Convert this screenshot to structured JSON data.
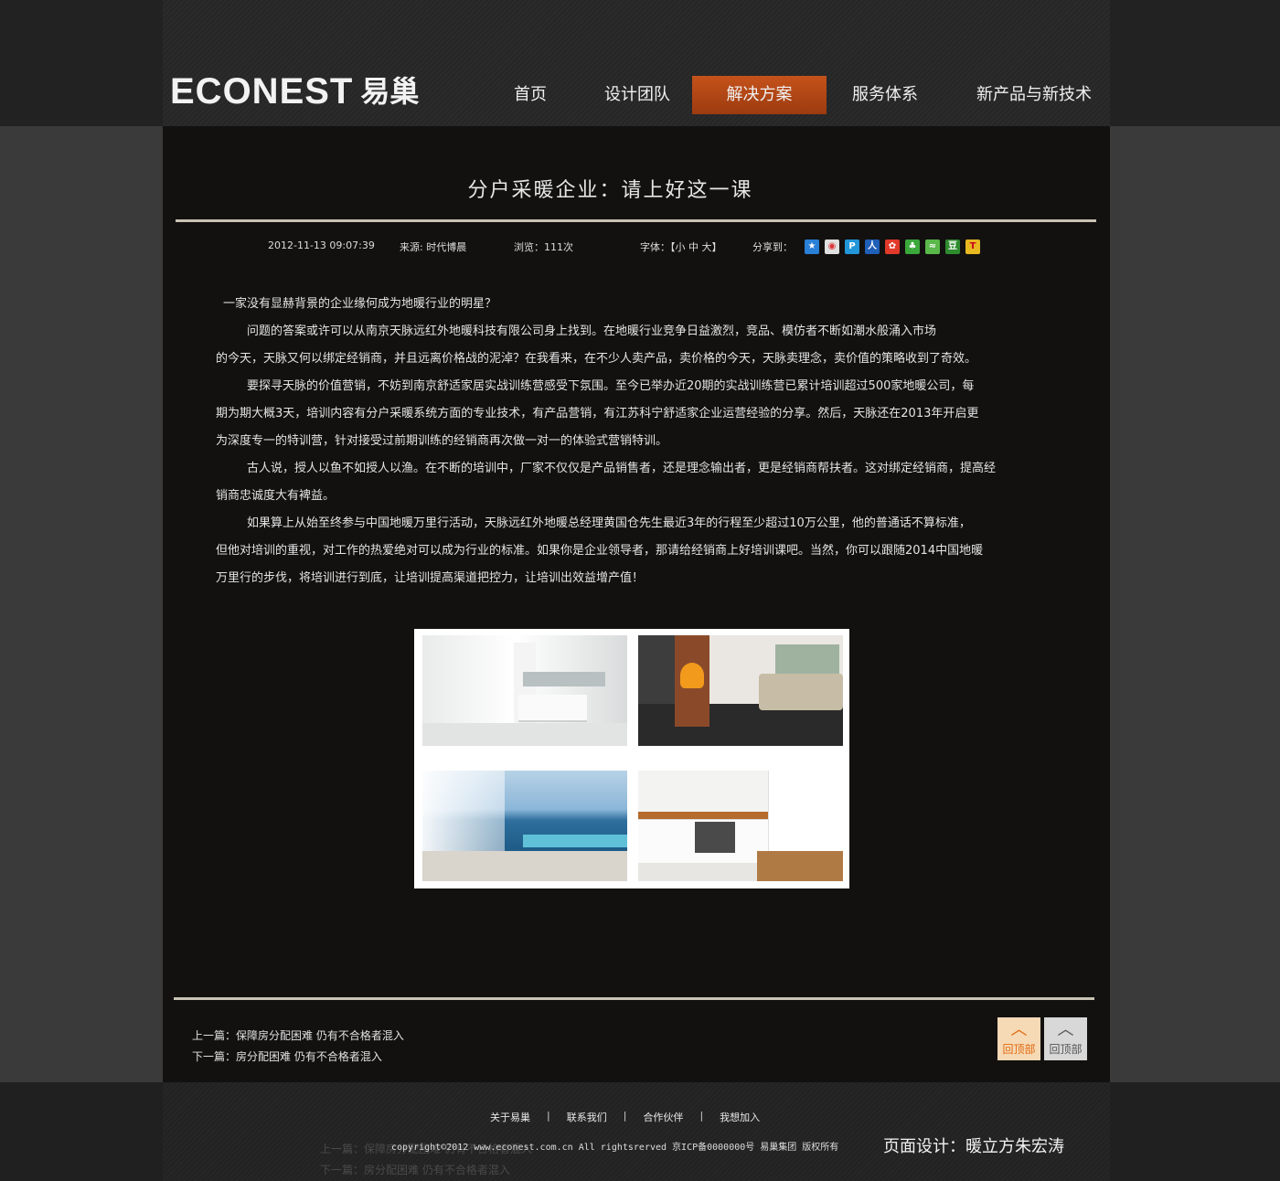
{
  "header": {
    "logo_text": "ECONEST",
    "logo_cn": "易巢",
    "nav": [
      {
        "label": "首页",
        "active": false
      },
      {
        "label": "设计团队",
        "active": false
      },
      {
        "label": "解决方案",
        "active": true
      },
      {
        "label": "服务体系",
        "active": false
      },
      {
        "label": "新产品与新技术",
        "active": false
      }
    ]
  },
  "article": {
    "title": "分户采暖企业：请上好这一课",
    "date": "2012-11-13 09:07:39",
    "source": "来源: 时代博晨",
    "views": "浏览：111次",
    "font_size_label": "字体：【小  中  大】",
    "share_label": "分享到：",
    "share_icons": [
      "qzone-icon",
      "weibo-icon",
      "pengyou-icon",
      "renren-icon",
      "kaixin-icon",
      "clover-icon",
      "tqq-icon",
      "douban-icon",
      "tieba-icon"
    ],
    "paragraphs": [
      "一家没有显赫背景的企业缘何成为地暖行业的明星？",
      "问题的答案或许可以从南京天脉远红外地暖科技有限公司身上找到。在地暖行业竞争日益激烈，竞品、模仿者不断如潮水般涌入市场",
      "的今天，天脉又何以绑定经销商，并且远离价格战的泥淖？在我看来，在不少人卖产品，卖价格的今天，天脉卖理念，卖价值的策略收到了奇效。",
      "要探寻天脉的价值营销，不妨到南京舒适家居实战训练营感受下氛围。至今已举办近20期的实战训练营已累计培训超过500家地暖公司，每",
      "期为期大概3天，培训内容有分户采暖系统方面的专业技术，有产品营销，有江苏科宁舒适家企业运营经验的分享。然后，天脉还在2013年开启更",
      "为深度专一的特训营，针对接受过前期训练的经销商再次做一对一的体验式营销特训。",
      "古人说，授人以鱼不如授人以渔。在不断的培训中，厂家不仅仅是产品销售者，还是理念输出者，更是经销商帮扶者。这对绑定经销商，提高经",
      "销商忠诚度大有裨益。",
      "如果算上从始至终参与中国地暖万里行活动，天脉远红外地暖总经理黄国仓先生最近3年的行程至少超过10万公里，他的普通话不算标准，",
      "但他对培训的重视，对工作的热爱绝对可以成为行业的标准。如果你是企业领导者，那请给经销商上好培训课吧。当然，你可以跟随2014中国地暖",
      "万里行的步伐，将培训进行到底，让培训提高渠道把控力，让培训出效益增产值！"
    ]
  },
  "pager": {
    "prev": "上一篇：保障房分配困难 仍有不合格者混入",
    "next": "下一篇：房分配困难 仍有不合格者混入",
    "back_top_1": "回顶部",
    "back_top_2": "回顶部"
  },
  "footer": {
    "links": [
      "关于易巢",
      "联系我们",
      "合作伙伴",
      "我想加入"
    ],
    "copyright": "copyright©2012 www.econest.com.cn All rightsrerved 京ICP备0000000号 易巢集团 版权所有",
    "designer": "页面设计：暖立方朱宏涛",
    "ghost_prev": "上一篇：保障房分配困难 仍有不合格者混入",
    "ghost_next": "下一篇：房分配困难 仍有不合格者混入"
  },
  "colors": {
    "accent": "#b84a16",
    "rule": "#c9c3b4",
    "panel": "#121110",
    "back_top_orange": "#f6d9b5",
    "back_top_grey": "#d8d8d8"
  }
}
